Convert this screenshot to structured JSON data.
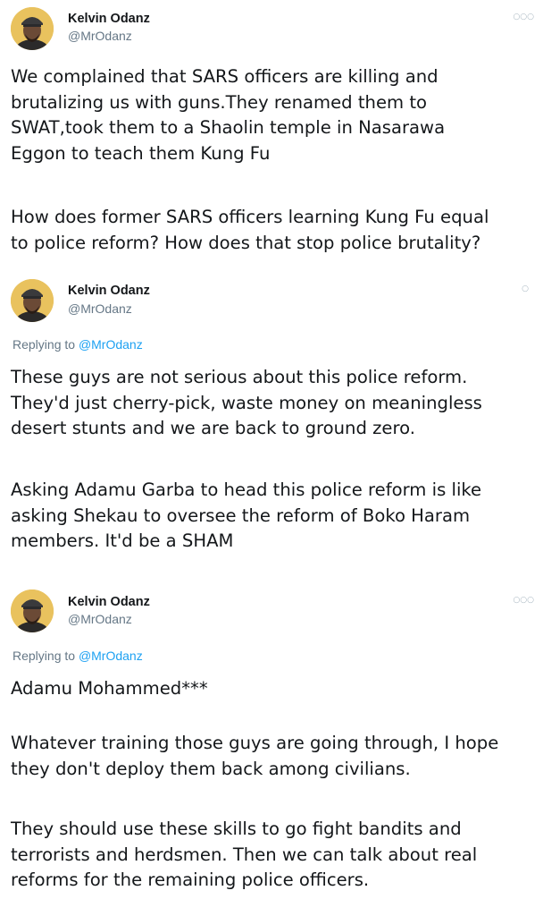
{
  "tweets": [
    {
      "author": {
        "name": "Kelvin Odanz",
        "handle": "@MrOdanz"
      },
      "more_icon": "more-dots-icon",
      "paragraphs": [
        "We complained that SARS officers are killing and\nbrutalizing us with guns.They  renamed them to\nSWAT,took them to a Shaolin temple in Nasarawa\nEggon to teach them Kung Fu",
        "How does former SARS officers learning Kung Fu equal\nto police reform? How does that stop police brutality?"
      ]
    },
    {
      "author": {
        "name": "Kelvin Odanz",
        "handle": "@MrOdanz"
      },
      "replying_label": "Replying to",
      "replying_handle": "@MrOdanz",
      "paragraphs": [
        "These guys are not serious about this police reform.\nThey'd just cherry-pick, waste money on meaningless\ndesert stunts and we are back to ground zero.",
        "Asking Adamu Garba to head this police reform is like\nasking Shekau to oversee the reform of Boko Haram\nmembers. It'd be a SHAM"
      ]
    },
    {
      "author": {
        "name": "Kelvin Odanz",
        "handle": "@MrOdanz"
      },
      "replying_label": "Replying to",
      "replying_handle": "@MrOdanz",
      "paragraphs": [
        "Adamu Mohammed***",
        "Whatever training those guys are going through, I hope\nthey don't deploy them back among civilians.",
        "They should use these skills to go fight bandits and\nterrorists and herdsmen. Then we can talk about real\nreforms for the remaining police officers."
      ]
    }
  ]
}
